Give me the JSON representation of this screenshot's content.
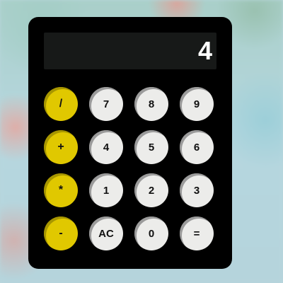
{
  "display": {
    "value": "4"
  },
  "keys": [
    {
      "label": "/",
      "kind": "operator",
      "name": "divide-button"
    },
    {
      "label": "7",
      "kind": "digit",
      "name": "digit-7-button"
    },
    {
      "label": "8",
      "kind": "digit",
      "name": "digit-8-button"
    },
    {
      "label": "9",
      "kind": "digit",
      "name": "digit-9-button"
    },
    {
      "label": "+",
      "kind": "operator",
      "name": "add-button"
    },
    {
      "label": "4",
      "kind": "digit",
      "name": "digit-4-button"
    },
    {
      "label": "5",
      "kind": "digit",
      "name": "digit-5-button"
    },
    {
      "label": "6",
      "kind": "digit",
      "name": "digit-6-button"
    },
    {
      "label": "*",
      "kind": "operator",
      "name": "multiply-button"
    },
    {
      "label": "1",
      "kind": "digit",
      "name": "digit-1-button"
    },
    {
      "label": "2",
      "kind": "digit",
      "name": "digit-2-button"
    },
    {
      "label": "3",
      "kind": "digit",
      "name": "digit-3-button"
    },
    {
      "label": "-",
      "kind": "operator",
      "name": "subtract-button"
    },
    {
      "label": "AC",
      "kind": "digit",
      "name": "clear-button"
    },
    {
      "label": "0",
      "kind": "digit",
      "name": "digit-0-button"
    },
    {
      "label": "=",
      "kind": "digit",
      "name": "equals-button"
    }
  ],
  "colors": {
    "operator_key": "#e0c800",
    "digit_key": "#ececea",
    "body": "#000000",
    "display": "#171918"
  }
}
